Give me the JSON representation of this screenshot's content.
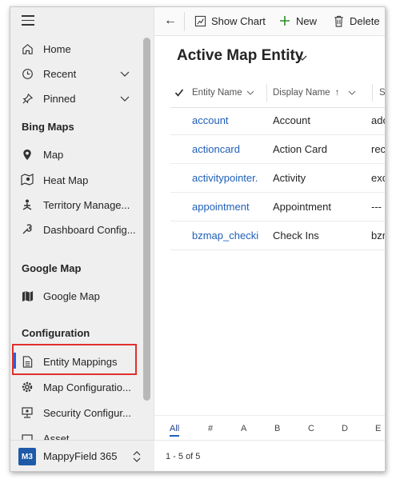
{
  "sidebar": {
    "items": [
      {
        "label": "Home",
        "icon": "home-icon"
      },
      {
        "label": "Recent",
        "icon": "clock-icon"
      },
      {
        "label": "Pinned",
        "icon": "pin-icon"
      }
    ],
    "sections": [
      {
        "title": "Bing Maps",
        "items": [
          {
            "label": "Map",
            "icon": "map-pin-icon"
          },
          {
            "label": "Heat Map",
            "icon": "heat-map-icon"
          },
          {
            "label": "Territory Manage...",
            "icon": "territory-icon"
          },
          {
            "label": "Dashboard Config...",
            "icon": "dashboard-config-icon"
          }
        ]
      },
      {
        "title": "Google Map",
        "items": [
          {
            "label": "Google Map",
            "icon": "folded-map-icon"
          }
        ]
      },
      {
        "title": "Configuration",
        "items": [
          {
            "label": "Entity Mappings",
            "icon": "document-icon"
          },
          {
            "label": "Map Configuratio...",
            "icon": "gear-icon"
          },
          {
            "label": "Security Configur...",
            "icon": "security-icon"
          },
          {
            "label": "Asset",
            "icon": "asset-icon"
          }
        ]
      }
    ],
    "footer": {
      "badge": "M3",
      "app_name": "MappyField 365"
    }
  },
  "command_bar": {
    "back": "←",
    "show_chart": "Show Chart",
    "new": "New",
    "delete": "Delete"
  },
  "view": {
    "title": "Active Map Entity"
  },
  "grid": {
    "columns": [
      "Entity Name",
      "Display Name",
      "Stre"
    ],
    "sort_indicator": "↑",
    "rows": [
      {
        "entity": "account",
        "display": "Account",
        "third": "ado"
      },
      {
        "entity": "actioncard",
        "display": "Action Card",
        "third": "rec"
      },
      {
        "entity": "activitypointer.",
        "display": "Activity",
        "third": "exo"
      },
      {
        "entity": "appointment",
        "display": "Appointment",
        "third": "---"
      },
      {
        "entity": "bzmap_checkin",
        "display": "Check Ins",
        "third": "bzm"
      }
    ]
  },
  "alpha_filter": [
    "All",
    "#",
    "A",
    "B",
    "C",
    "D",
    "E"
  ],
  "pager": {
    "text": "1 - 5 of 5"
  },
  "colors": {
    "accent": "#1f5fb8",
    "highlight": "#e0302d",
    "badge": "#1f5aa8"
  }
}
